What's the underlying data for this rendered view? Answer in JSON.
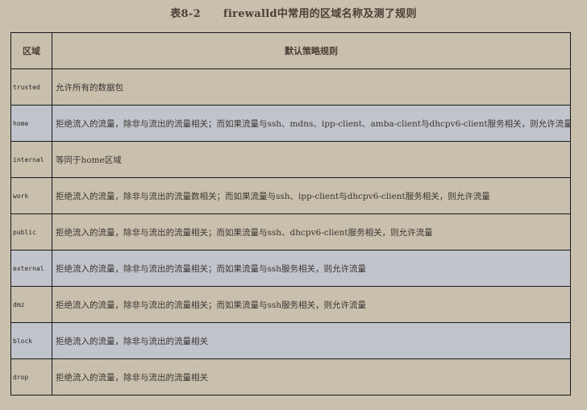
{
  "caption": {
    "number": "表8-2",
    "title": "firewalld中常用的区域名称及测了规则"
  },
  "table": {
    "headers": [
      "区域",
      "默认策略规则"
    ],
    "rows": [
      {
        "zone": "trusted",
        "rule": "允许所有的数据包"
      },
      {
        "zone": "home",
        "rule": "拒绝流入的流量，除非与流出的流量相关；而如果流量与ssh、mdns、ipp-client、amba-client与dhcpv6-client服务相关，则允许流量"
      },
      {
        "zone": "internal",
        "rule": "等同于home区域"
      },
      {
        "zone": "work",
        "rule": "拒绝流入的流量，除非与流出的流量数相关；而如果流量与ssh、ipp-client与dhcpv6-client服务相关，则允许流量"
      },
      {
        "zone": "public",
        "rule": "拒绝流入的流量，除非与流出的流量相关；而如果流量与ssh、dhcpv6-client服务相关，则允许流量"
      },
      {
        "zone": "external",
        "rule": "拒绝流入的流量，除非与流出的流量相关；而如果流量与ssh服务相关，则允许流量"
      },
      {
        "zone": "dmz",
        "rule": "拒绝流入的流量，除非与流出的流量相关；而如果流量与ssh服务相关，则允许流量"
      },
      {
        "zone": "block",
        "rule": "拒绝流入的流量，除非与流出的流量相关"
      },
      {
        "zone": "drop",
        "rule": "拒绝流入的流量，除非与流出的流量相关"
      }
    ]
  }
}
